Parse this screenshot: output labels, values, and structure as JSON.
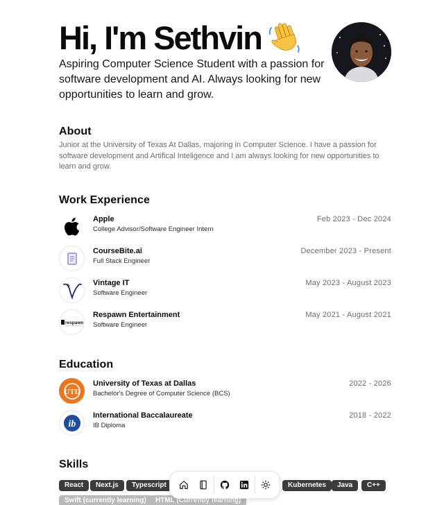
{
  "hero": {
    "title": "Hi, I'm Sethvin",
    "wave_icon": "waving-hand-emoji",
    "subtitle": "Aspiring Computer Science Student with a passion for software development and AI. Always looking for new opportunities to learn and grow."
  },
  "about": {
    "title": "About",
    "text": "Junior at the University of Texas At Dallas, majoring in Computer Science. I have a passion for software development and Artifical Inteligence and I am always looking for new opportunities to learn and grow."
  },
  "work": {
    "title": "Work Experience",
    "items": [
      {
        "name": "Apple",
        "role": "College Advisor/Software Engineer Intern",
        "date": "Feb 2023 - Dec 2024",
        "icon": "apple-logo-icon"
      },
      {
        "name": "CourseBite.ai",
        "role": "Full Stack Engineer",
        "date": "December 2023 - Present",
        "icon": "coursebite-logo-icon"
      },
      {
        "name": "Vintage IT",
        "role": "Software Engineer",
        "date": "May 2023 - August 2023",
        "icon": "vintage-it-logo-icon"
      },
      {
        "name": "Respawn Entertainment",
        "role": "Software Engineer",
        "date": "May 2021 - August 2021",
        "icon": "respawn-logo-icon"
      }
    ]
  },
  "education": {
    "title": "Education",
    "items": [
      {
        "name": "University of Texas at Dallas",
        "role": "Bachelor's Degree of Computer Science (BCS)",
        "date": "2022 - 2026",
        "icon": "utd-logo-icon"
      },
      {
        "name": "International Baccalaureate",
        "role": "IB Diploma",
        "date": "2018 - 2022",
        "icon": "ib-logo-icon"
      }
    ]
  },
  "respawn_logo_text": "respawn",
  "skills": {
    "title": "Skills",
    "items": [
      "React",
      "Next.js",
      "Typescript",
      "Kubernetes",
      "Java",
      "C++",
      "Swift (currently learning)",
      "HTML (Currently learning)"
    ]
  },
  "dock": {
    "items": [
      "home-icon",
      "notebook-icon",
      "github-icon",
      "linkedin-icon",
      "sun-icon"
    ]
  },
  "colors": {
    "chip": "#3b3b3b",
    "chip_faded": "#b9b9b9",
    "utd_orange": "#e87722",
    "ib_blue": "#1c4e9c"
  }
}
